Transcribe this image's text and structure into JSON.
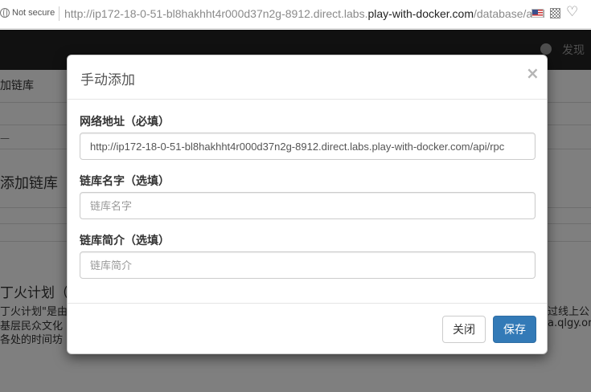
{
  "browser": {
    "security_label": "Not secure",
    "url_prefix": "http://ip172-18-0-51-bl8hakhht4r000d37n2g-8912.direct.labs.",
    "url_host": "play-with-docker.com",
    "url_path": "/database/add"
  },
  "navbar": {
    "discover_label": "发现"
  },
  "page": {
    "breadcrumb": "加链库",
    "dash": "—",
    "heading": "添加链库",
    "section_title": "丁火计划（丝",
    "para_lines": [
      "丁火计划\"是由钅",
      "基层民众文化",
      "各处的时间坊"
    ],
    "right_lines": [
      "过线上公",
      "a.qlgy.org"
    ]
  },
  "modal": {
    "title": "手动添加",
    "close_symbol": "×",
    "fields": [
      {
        "label": "网络地址（必填）",
        "value": "http://ip172-18-0-51-bl8hakhht4r000d37n2g-8912.direct.labs.play-with-docker.com/api/rpc",
        "placeholder": ""
      },
      {
        "label": "链库名字（选填）",
        "value": "",
        "placeholder": "链库名字"
      },
      {
        "label": "链库简介（选填）",
        "value": "",
        "placeholder": "链库简介"
      }
    ],
    "buttons": {
      "close_label": "关闭",
      "save_label": "保存"
    }
  },
  "colors": {
    "primary": "#337ab7",
    "navbar": "#222222"
  },
  "icons": [
    "globe-icon",
    "flag-icon",
    "qr-code-icon",
    "heart-icon",
    "close-icon"
  ]
}
